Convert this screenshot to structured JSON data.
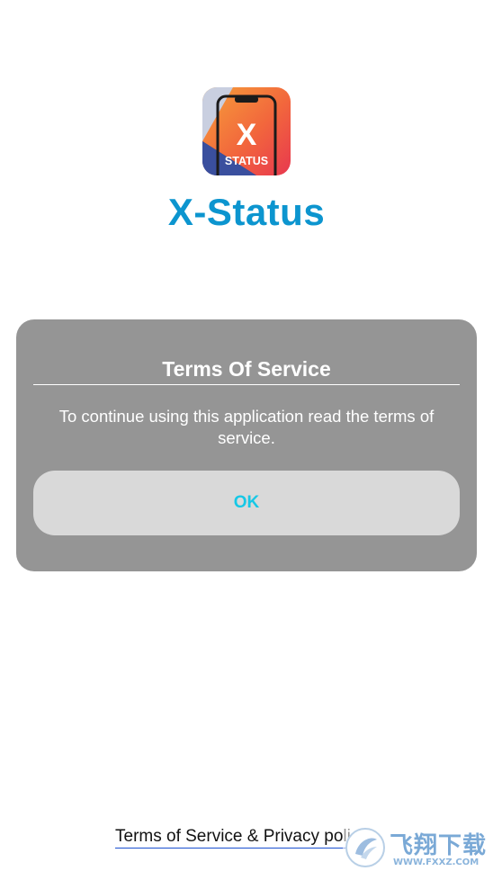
{
  "app": {
    "icon_name": "x-status-app-icon",
    "icon_letter": "X",
    "icon_caption": "STATUS",
    "title": "X-Status",
    "title_color": "#0c95cf"
  },
  "dialog": {
    "title": "Terms Of Service",
    "message": "To continue using this application read the terms of service.",
    "ok_label": "OK",
    "background": "#959595",
    "button_background": "#d9d9d9",
    "button_text_color": "#16c8e6"
  },
  "footer": {
    "link_label": "Terms of Service & Privacy policy"
  },
  "watermark": {
    "icon_name": "fxxz-logo-icon",
    "text": "飞翔下载",
    "url": "WWW.FXXZ.COM"
  }
}
